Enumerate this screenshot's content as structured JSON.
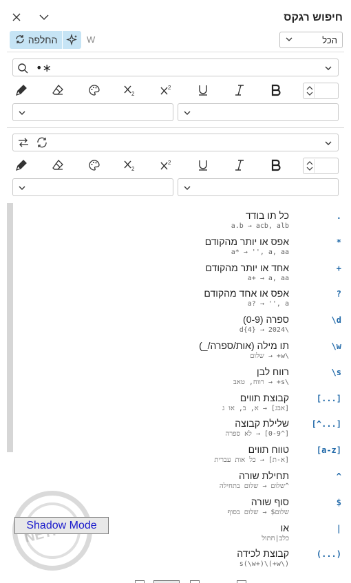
{
  "header": {
    "title": "חיפוש רגקס",
    "close_icon": "close-icon",
    "collapse_icon": "chevron-down-icon"
  },
  "toolbar": {
    "scope_value": "הכל",
    "replace_label": "החלפה",
    "whole_word_label": "W"
  },
  "find": {
    "value": "•∗",
    "color_field": "",
    "style_field": "",
    "font_size": ""
  },
  "replace": {
    "value": "",
    "font_size": ""
  },
  "regex_items": [
    {
      "token": ".",
      "label": "כל תו בודד",
      "example": "a.b → acb, alb"
    },
    {
      "token": "*",
      "label": "אפס או יותר מהקודם",
      "example": "a* → '', a, aa"
    },
    {
      "token": "+",
      "label": "אחד או יותר מהקודם",
      "example": "a+ → a, aa"
    },
    {
      "token": "?",
      "label": "אפס או אחד מהקודם",
      "example": "a? → '', a"
    },
    {
      "token": "\\d",
      "label": "ספרה (0-9)",
      "example": "\\d{4} → 2024"
    },
    {
      "token": "\\w",
      "label": "תו מילה (אות/ספרה/_)",
      "example": "\\w+ → שלום"
    },
    {
      "token": "\\s",
      "label": "רווח לבן",
      "example": "\\s+ → רווח, טאב"
    },
    {
      "token": "[...]",
      "label": "קבוצת תווים",
      "example": "[אבג] → א, ב, או ג"
    },
    {
      "token": "[^...]",
      "label": "שלילת קבוצה",
      "example": "[^0-9] → לא ספרה"
    },
    {
      "token": "[a-z]",
      "label": "טווח תווים",
      "example": "[א-ת] → כל אות עברית"
    },
    {
      "token": "^",
      "label": "תחילת שורה",
      "example": "^שלום → שלום בתחילה"
    },
    {
      "token": "$",
      "label": "סוף שורה",
      "example": "שלום$ → שלום בסוף"
    },
    {
      "token": "|",
      "label": "או",
      "example": "כלב|חתול"
    },
    {
      "token": "(...)",
      "label": "קבוצת לכידה",
      "example": "(\\w+)\\s(\\w+)"
    }
  ],
  "watermark": {
    "text": "NETFREE"
  },
  "shadow_mode": {
    "label": "Shadow Mode"
  }
}
